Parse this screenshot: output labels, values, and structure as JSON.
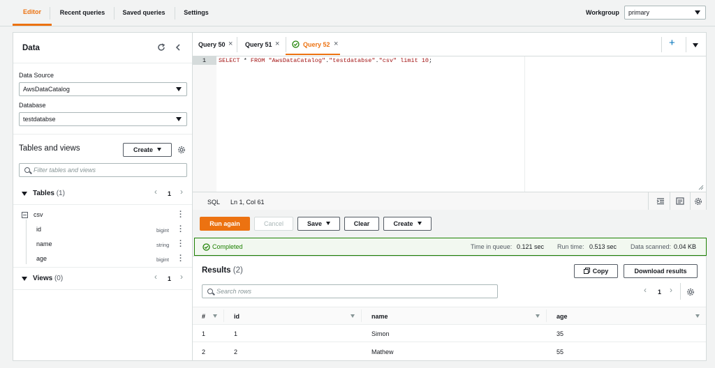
{
  "nav": {
    "tabs": [
      "Editor",
      "Recent queries",
      "Saved queries",
      "Settings"
    ],
    "workgroup_label": "Workgroup",
    "workgroup_value": "primary"
  },
  "sidebar": {
    "title": "Data",
    "data_source_label": "Data Source",
    "data_source_value": "AwsDataCatalog",
    "database_label": "Database",
    "database_value": "testdatabse",
    "tables_views_title": "Tables and views",
    "create_label": "Create",
    "filter_placeholder": "Filter tables and views",
    "tables_label": "Tables",
    "tables_count": "(1)",
    "tables_page": "1",
    "table_name": "csv",
    "columns": [
      {
        "name": "id",
        "type": "bigint"
      },
      {
        "name": "name",
        "type": "string"
      },
      {
        "name": "age",
        "type": "bigint"
      }
    ],
    "views_label": "Views",
    "views_count": "(0)",
    "views_page": "1"
  },
  "editor": {
    "query_tabs": [
      "Query 50",
      "Query 51",
      "Query 52"
    ],
    "line_number": "1",
    "sql_parts": {
      "kw1": "SELECT",
      "star": " * ",
      "kw2": "FROM",
      "s1": "\"AwsDataCatalog\"",
      "dot1": ".",
      "s2": "\"testdatabse\"",
      "dot2": ".",
      "s3": "\"csv\"",
      "kw3": " limit ",
      "num": "10",
      "semi": ";"
    },
    "status_lang": "SQL",
    "status_pos": "Ln 1, Col 61"
  },
  "actions": {
    "run_again": "Run again",
    "cancel": "Cancel",
    "save": "Save",
    "clear": "Clear",
    "create": "Create"
  },
  "status": {
    "completed": "Completed",
    "time_in_queue_label": "Time in queue:",
    "time_in_queue_value": "0.121 sec",
    "run_time_label": "Run time:",
    "run_time_value": "0.513 sec",
    "data_scanned_label": "Data scanned:",
    "data_scanned_value": "0.04 KB"
  },
  "results": {
    "title": "Results",
    "count": "(2)",
    "copy_label": "Copy",
    "download_label": "Download results",
    "search_placeholder": "Search rows",
    "page": "1",
    "headers": [
      "#",
      "id",
      "name",
      "age"
    ],
    "rows": [
      [
        "1",
        "1",
        "Simon",
        "35"
      ],
      [
        "2",
        "2",
        "Mathew",
        "55"
      ]
    ]
  },
  "colors": {
    "accent": "#ec7211",
    "success": "#1d8102",
    "link": "#0073bb"
  }
}
